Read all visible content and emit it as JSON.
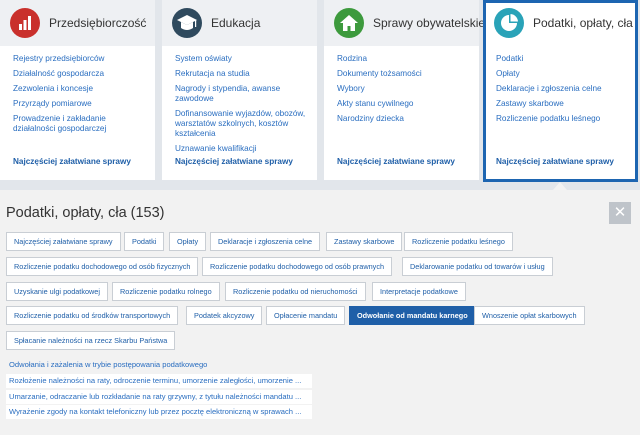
{
  "cards": [
    {
      "title": "Przedsiębiorczość",
      "icon": "bar-chart-icon",
      "items": [
        "Rejestry przedsiębiorców",
        "Działalność gospodarcza",
        "Zezwolenia i koncesje",
        "Przyrządy pomiarowe",
        "Prowadzenie i zakładanie działalności gospodarczej"
      ],
      "most": "Najczęściej załatwiane sprawy"
    },
    {
      "title": "Edukacja",
      "icon": "graduation-cap-icon",
      "items": [
        "System oświaty",
        "Rekrutacja na studia",
        "Nagrody i stypendia, awanse zawodowe",
        "Dofinansowanie wyjazdów, obozów, warsztatów szkolnych, kosztów kształcenia",
        "Uznawanie kwalifikacji"
      ],
      "most": "Najczęściej załatwiane sprawy"
    },
    {
      "title": "Sprawy obywatelskie",
      "icon": "house-icon",
      "items": [
        "Rodzina",
        "Dokumenty tożsamości",
        "Wybory",
        "Akty stanu cywilnego",
        "Narodziny dziecka"
      ],
      "most": "Najczęściej załatwiane sprawy"
    },
    {
      "title": "Podatki, opłaty, cła",
      "icon": "pie-chart-icon",
      "items": [
        "Podatki",
        "Opłaty",
        "Deklaracje i zgłoszenia celne",
        "Zastawy skarbowe",
        "Rozliczenie podatku leśnego"
      ],
      "most": "Najczęściej załatwiane sprawy"
    }
  ],
  "panel": {
    "title": "Podatki, opłaty, cła (153)",
    "close_label": "✕",
    "tags": [
      "Najczęściej załatwiane sprawy",
      "Podatki",
      "Opłaty",
      "Deklaracje i zgłoszenia celne",
      "Zastawy skarbowe",
      "Rozliczenie podatku leśnego",
      "Rozliczenie podatku dochodowego od osób fizycznych",
      "Rozliczenie podatku dochodowego od osób prawnych",
      "Deklarowanie podatku od towarów i usług",
      "Uzyskanie ulgi podatkowej",
      "Rozliczenie podatku rolnego",
      "Rozliczenie podatku od nieruchomości",
      "Interpretacje podatkowe",
      "Rozliczenie podatku od środków transportowych",
      "Podatek akcyzowy",
      "Opłacenie mandatu",
      "Odwołanie od mandatu karnego",
      "Wnoszenie opłat skarbowych",
      "Spłacanie należności na rzecz Skarbu Państwa"
    ],
    "selected_tag": "Odwołanie od mandatu karnego",
    "links": [
      "Odwołania i zażalenia w trybie postępowania podatkowego",
      "Rozłożenie należności na raty, odroczenie terminu, umorzenie zaległości, umorzenie ...",
      "Umarzanie, odraczanie lub rozkładanie na raty grzywny, z tytułu należności mandatu ...",
      "Wyrażenie zgody na kontakt telefoniczny lub przez pocztę elektroniczną w sprawach ..."
    ]
  },
  "colors": {
    "accent": "#1f5fa8",
    "link": "#2a6ec0",
    "icon_red": "#c9302c",
    "icon_dark": "#2f4a5e",
    "icon_green": "#3d9a3d",
    "icon_teal": "#2aa3b8"
  }
}
